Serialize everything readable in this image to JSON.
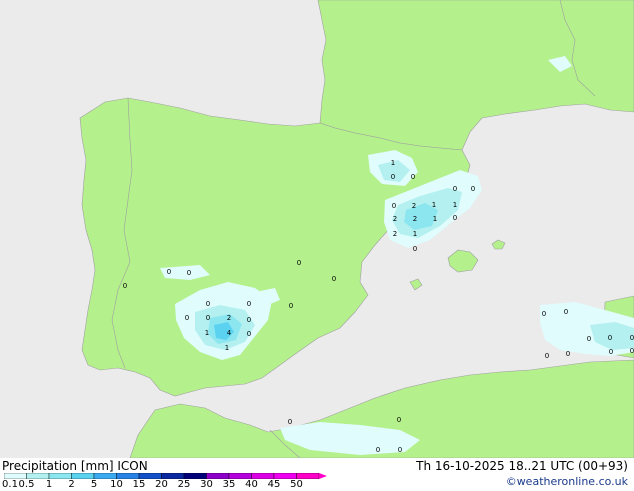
{
  "title_left": "Precipitation [mm] ICON",
  "title_right": "Th 16-10-2025 18..21 UTC (00+93)",
  "credit": "©weatheronline.co.uk",
  "colors": {
    "sea": "#ebebeb",
    "land": "#b4f08c",
    "border": "#a0a0a0"
  },
  "legend": {
    "ticks": [
      "0.1",
      "0.5",
      "1",
      "2",
      "5",
      "10",
      "15",
      "20",
      "25",
      "30",
      "35",
      "40",
      "45",
      "50"
    ],
    "colors": [
      "#e0fcfc",
      "#b4f0f0",
      "#8ce6f0",
      "#5ad2f0",
      "#3caaf0",
      "#2882e6",
      "#1450c8",
      "#0a28a0",
      "#000078",
      "#8c00c8",
      "#b400dc",
      "#dc00e6",
      "#f000f0",
      "#ff00c8"
    ]
  },
  "map_values": [
    "1",
    "0",
    "0",
    "0",
    "0",
    "2",
    "1",
    "1",
    "0",
    "2",
    "2",
    "1",
    "0",
    "2",
    "1",
    "0",
    "0",
    "0",
    "0",
    "0",
    "0",
    "0",
    "0",
    "0",
    "0",
    "2",
    "0",
    "1",
    "4",
    "0",
    "1",
    "0",
    "0",
    "0",
    "0",
    "0",
    "0",
    "0",
    "0",
    "0",
    "0",
    "0",
    "0",
    "0",
    "0"
  ]
}
